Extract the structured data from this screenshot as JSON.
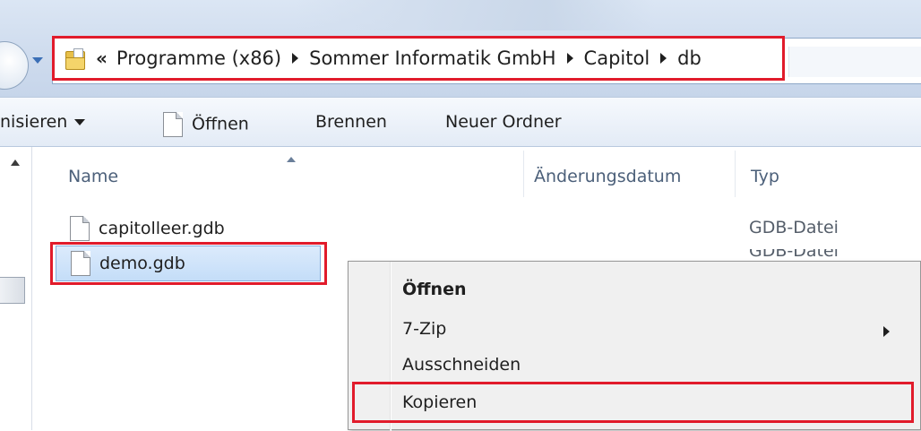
{
  "address_bar": {
    "overflow_label": "«",
    "breadcrumbs": [
      "Programme (x86)",
      "Sommer Informatik GmbH",
      "Capitol",
      "db"
    ]
  },
  "toolbar": {
    "organize_label": "nisieren",
    "open_label": "Öffnen",
    "burn_label": "Brennen",
    "new_folder_label": "Neuer Ordner"
  },
  "columns": {
    "name": "Name",
    "date_modified": "Änderungsdatum",
    "type": "Typ"
  },
  "files": [
    {
      "name": "capitolleer.gdb",
      "type": "GDB-Datei",
      "selected": false
    },
    {
      "name": "demo.gdb",
      "type": "GDB-Datei",
      "selected": true
    }
  ],
  "context_menu": {
    "items": [
      "Öffnen",
      "7-Zip",
      "Ausschneiden",
      "Kopieren"
    ]
  },
  "colors": {
    "highlight_box": "#e11b2b",
    "selection_fill": "#cfe3fa",
    "toolbar_bg": "#e9f0f8"
  }
}
